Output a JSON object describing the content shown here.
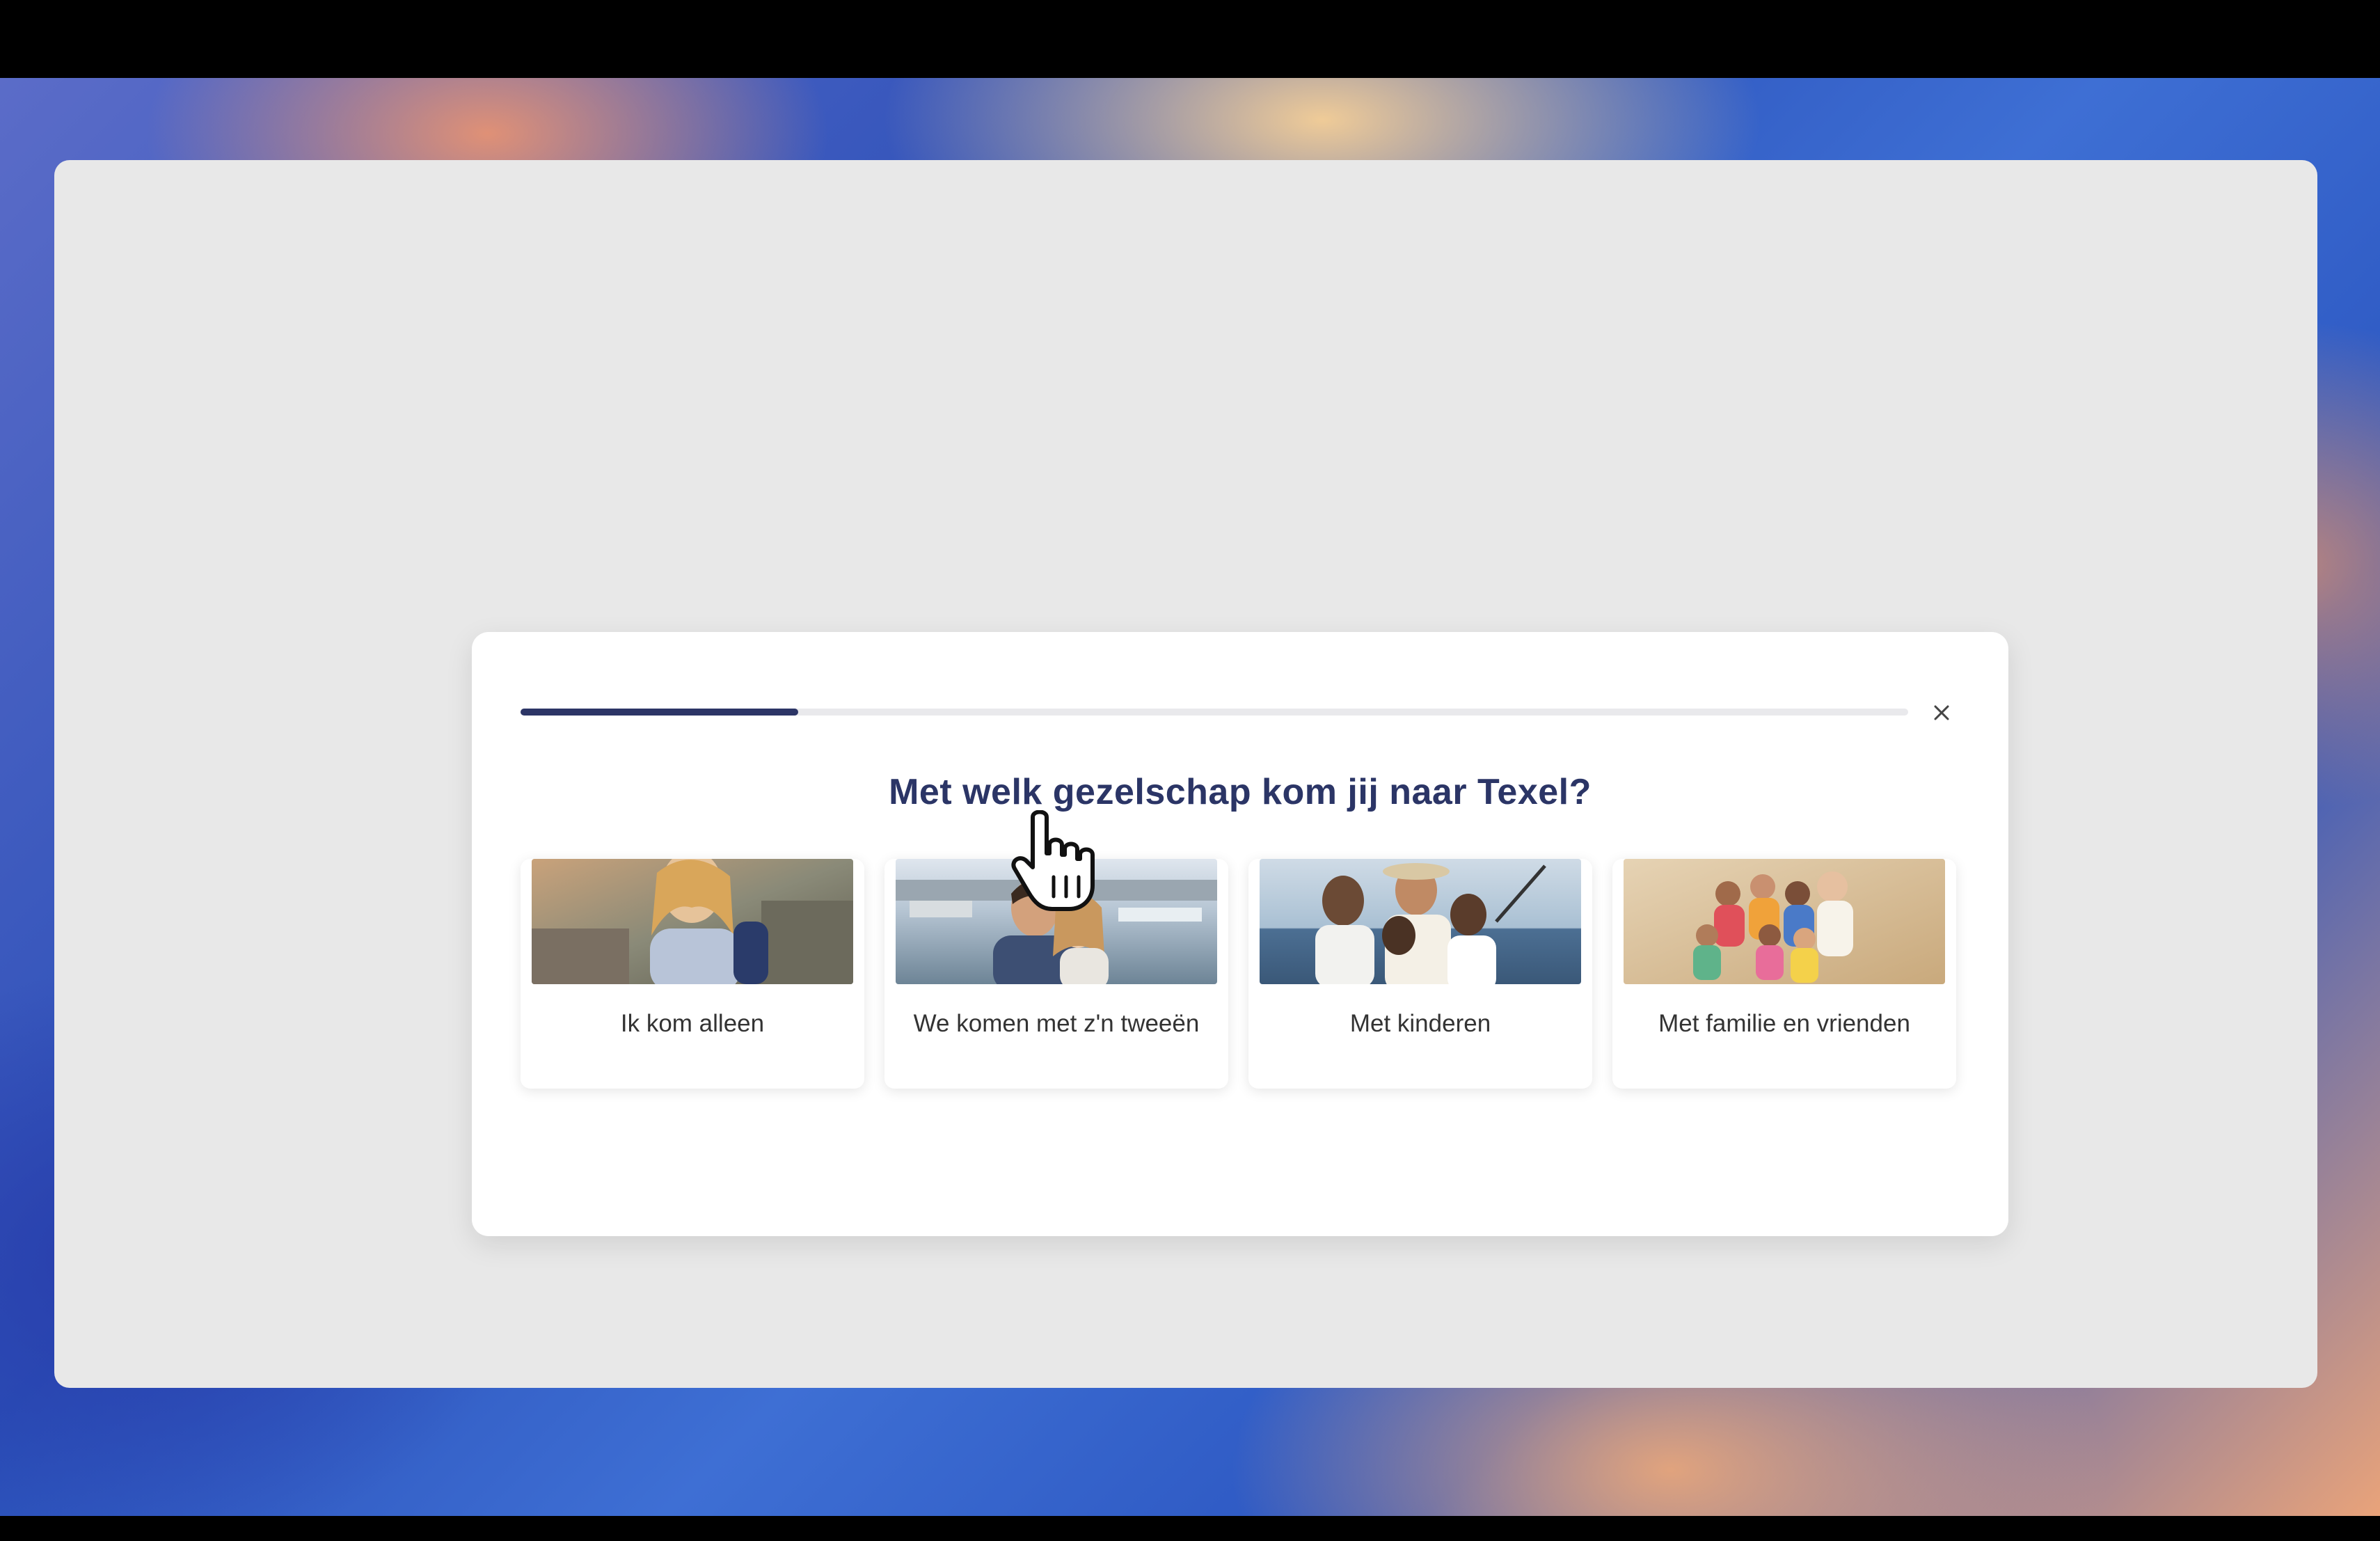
{
  "modal": {
    "progress_fraction": 0.2,
    "close_label": "×",
    "title": "Met welk gezelschap kom jij naar Texel?",
    "options": [
      {
        "label": "Ik kom alleen",
        "image": "solo-traveler-photo"
      },
      {
        "label": "We komen met z'n tweeën",
        "image": "couple-selfie-photo"
      },
      {
        "label": "Met kinderen",
        "image": "family-with-kids-photo"
      },
      {
        "label": "Met familie en vrienden",
        "image": "group-friends-beach-photo"
      }
    ]
  },
  "colors": {
    "accent": "#2c3566",
    "title": "#2b3566",
    "window_bg": "#e8e8e8"
  },
  "cursor_icon": "hand-pointer-icon"
}
